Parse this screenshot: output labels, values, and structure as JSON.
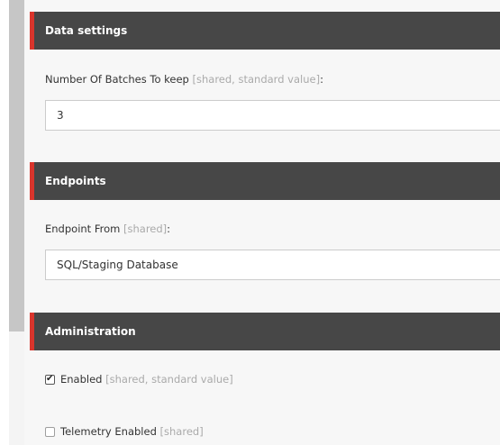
{
  "sections": [
    {
      "title": "Data settings",
      "fields": [
        {
          "label": "Number Of Batches To keep",
          "hint": "[shared, standard value]",
          "value": "3"
        }
      ]
    },
    {
      "title": "Endpoints",
      "fields": [
        {
          "label": "Endpoint From",
          "hint": "[shared]",
          "value": "SQL/Staging Database"
        }
      ]
    },
    {
      "title": "Administration",
      "checkboxes": [
        {
          "label": "Enabled",
          "hint": "[shared, standard value]",
          "checked": true
        },
        {
          "label": "Telemetry Enabled",
          "hint": "[shared]",
          "checked": false
        }
      ]
    }
  ],
  "icons": {
    "check": "checkmark-icon"
  },
  "colors": {
    "header_bg": "#474747",
    "header_accent": "#d9352c",
    "hint_text": "#aaaaaa"
  }
}
